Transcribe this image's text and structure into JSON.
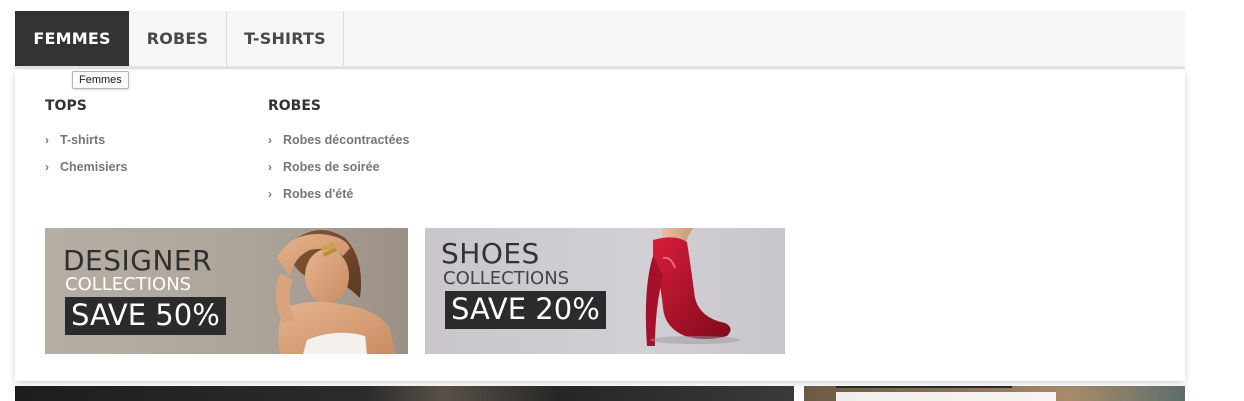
{
  "menu": {
    "tabs": [
      {
        "label": "FEMMES",
        "active": true
      },
      {
        "label": "ROBES",
        "active": false
      },
      {
        "label": "T-SHIRTS",
        "active": false
      }
    ],
    "tooltip": "Femmes"
  },
  "dropdown": {
    "columns": [
      {
        "title": "TOPS",
        "items": [
          "T-shirts",
          "Chemisiers"
        ]
      },
      {
        "title": "ROBES",
        "items": [
          "Robes décontractées",
          "Robes de soirée",
          "Robes d'été"
        ]
      }
    ],
    "chevron_icon": "chevron-right-icon"
  },
  "banners": [
    {
      "headline": "DESIGNER",
      "subline": "COLLECTIONS",
      "offer": "SAVE 50%"
    },
    {
      "headline": "SHOES",
      "subline": "COLLECTIONS",
      "offer": "SAVE 20%"
    }
  ],
  "colors": {
    "active_tab_bg": "#333333",
    "menu_bg": "#f6f6f6",
    "item_text": "#777777",
    "offer_bg": "#2b2b2b"
  }
}
